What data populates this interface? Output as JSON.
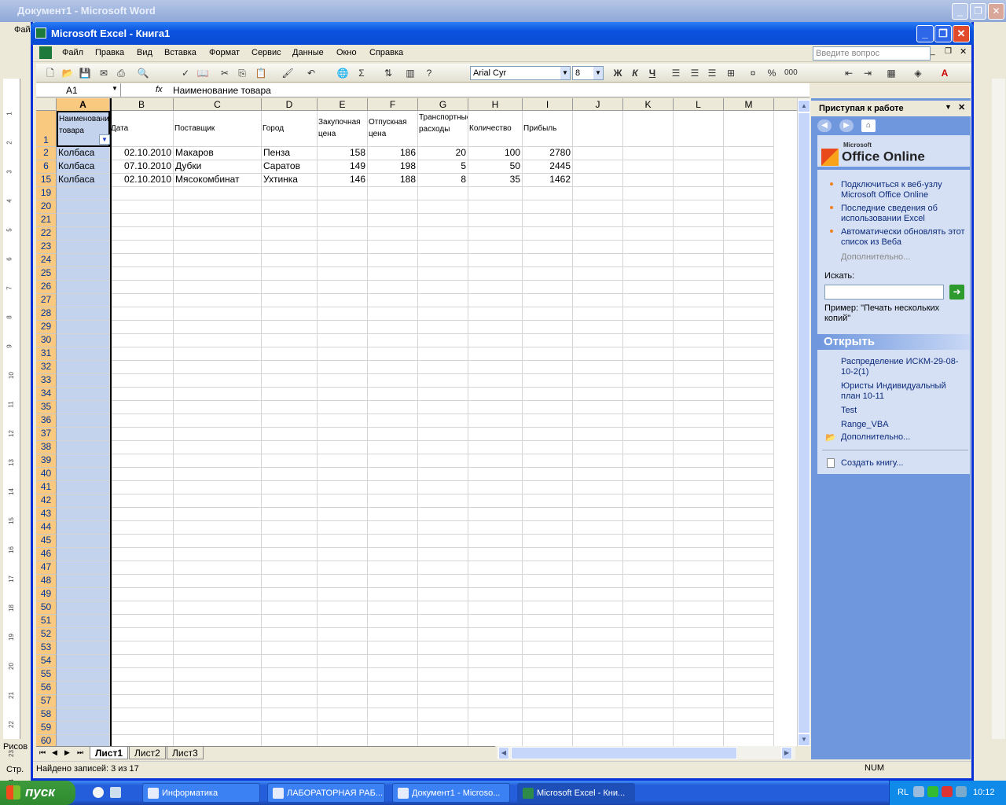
{
  "word": {
    "title": "Документ1 - Microsoft Word",
    "menu_first": "Файл",
    "ruler_ticks": [
      "1",
      "2",
      "3",
      "4",
      "5",
      "6",
      "7",
      "8",
      "9",
      "10",
      "11",
      "12",
      "13",
      "14",
      "15",
      "16",
      "17",
      "18",
      "19",
      "20",
      "21",
      "22",
      "23",
      "24",
      "25"
    ],
    "status_left": "Рисов",
    "page_label": "Стр."
  },
  "excel": {
    "title": "Microsoft Excel - Книга1",
    "menu": [
      "Файл",
      "Правка",
      "Вид",
      "Вставка",
      "Формат",
      "Сервис",
      "Данные",
      "Окно",
      "Справка"
    ],
    "ask_placeholder": "Введите вопрос",
    "font_name": "Arial Cyr",
    "font_size": "8",
    "fmt_bold": "Ж",
    "fmt_italic": "К",
    "fmt_underline": "Ч",
    "name_box": "A1",
    "fx": "fx",
    "formula": "Наименование товара",
    "columns": [
      "A",
      "B",
      "C",
      "D",
      "E",
      "F",
      "G",
      "H",
      "I",
      "J",
      "K",
      "L",
      "M"
    ],
    "headers": {
      "a": "Наименование товара",
      "b": "Дата",
      "c": "Поставщик",
      "d": "Город",
      "e": "Закупочная цена",
      "f": "Отпускная цена",
      "g": "Транспортные расходы",
      "h": "Количество",
      "i": "Прибыль"
    },
    "row_numbers": [
      "1",
      "2",
      "6",
      "15",
      "19",
      "20",
      "21",
      "22",
      "23",
      "24",
      "25",
      "26",
      "27",
      "28",
      "29",
      "30",
      "31",
      "32",
      "33",
      "34",
      "35",
      "36",
      "37",
      "38",
      "39",
      "40",
      "41",
      "42",
      "43",
      "44",
      "45",
      "46",
      "47",
      "48",
      "49",
      "50",
      "51",
      "52",
      "53",
      "54",
      "55",
      "56",
      "57",
      "58",
      "59",
      "60"
    ],
    "rows": [
      {
        "a": "Колбаса",
        "b": "02.10.2010",
        "c": "Макаров",
        "d": "Пенза",
        "e": "158",
        "f": "186",
        "g": "20",
        "h": "100",
        "i": "2780"
      },
      {
        "a": "Колбаса",
        "b": "07.10.2010",
        "c": "Дубки",
        "d": "Саратов",
        "e": "149",
        "f": "198",
        "g": "5",
        "h": "50",
        "i": "2445"
      },
      {
        "a": "Колбаса",
        "b": "02.10.2010",
        "c": "Мясокомбинат",
        "d": "Ухтинка",
        "e": "146",
        "f": "188",
        "g": "8",
        "h": "35",
        "i": "1462"
      }
    ],
    "sheets": [
      "Лист1",
      "Лист2",
      "Лист3"
    ],
    "status": "Найдено записей: 3 из 17",
    "num": "NUM"
  },
  "pane": {
    "title": "Приступая к работе",
    "logo_small": "Microsoft",
    "logo": "Office Online",
    "links": [
      "Подключиться к веб-узлу Microsoft Office Online",
      "Последние сведения об использовании Excel",
      "Автоматически обновлять этот список из Веба"
    ],
    "more": "Дополнительно...",
    "search_label": "Искать:",
    "example": "Пример: \"Печать нескольких копий\"",
    "open_title": "Открыть",
    "files": [
      "Распределение ИСКМ-29-08-10-2(1)",
      "Юристы Индивидуальный план 10-11",
      "Test",
      "Range_VBA"
    ],
    "open_more": "Дополнительно...",
    "create": "Создать книгу..."
  },
  "taskbar": {
    "start": "пуск",
    "tasks": [
      "Информатика",
      "ЛАБОРАТОРНАЯ РАБ...",
      "Документ1 - Microso...",
      "Microsoft Excel - Кни..."
    ],
    "lang": "RL",
    "clock": "10:12"
  }
}
